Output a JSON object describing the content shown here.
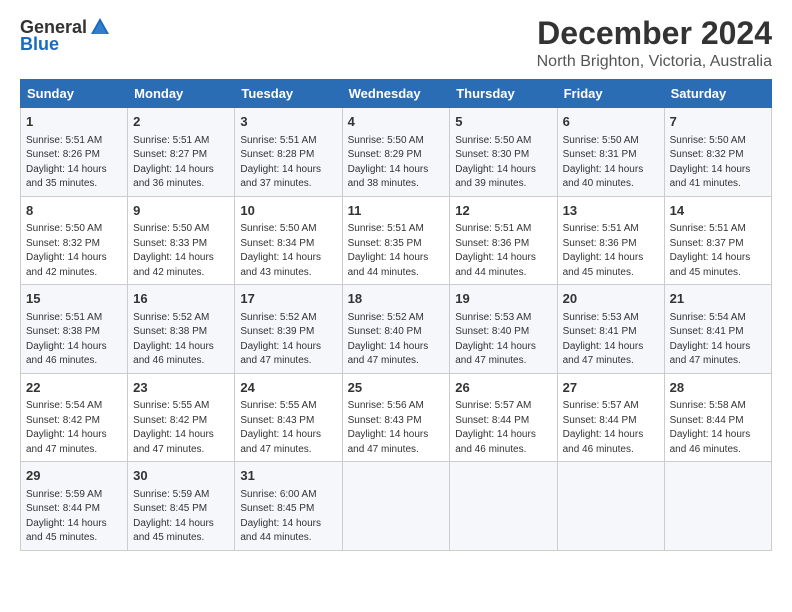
{
  "logo": {
    "general": "General",
    "blue": "Blue"
  },
  "header": {
    "month": "December 2024",
    "location": "North Brighton, Victoria, Australia"
  },
  "weekdays": [
    "Sunday",
    "Monday",
    "Tuesday",
    "Wednesday",
    "Thursday",
    "Friday",
    "Saturday"
  ],
  "weeks": [
    [
      {
        "day": "1",
        "sunrise": "5:51 AM",
        "sunset": "8:26 PM",
        "daylight": "14 hours and 35 minutes."
      },
      {
        "day": "2",
        "sunrise": "5:51 AM",
        "sunset": "8:27 PM",
        "daylight": "14 hours and 36 minutes."
      },
      {
        "day": "3",
        "sunrise": "5:51 AM",
        "sunset": "8:28 PM",
        "daylight": "14 hours and 37 minutes."
      },
      {
        "day": "4",
        "sunrise": "5:50 AM",
        "sunset": "8:29 PM",
        "daylight": "14 hours and 38 minutes."
      },
      {
        "day": "5",
        "sunrise": "5:50 AM",
        "sunset": "8:30 PM",
        "daylight": "14 hours and 39 minutes."
      },
      {
        "day": "6",
        "sunrise": "5:50 AM",
        "sunset": "8:31 PM",
        "daylight": "14 hours and 40 minutes."
      },
      {
        "day": "7",
        "sunrise": "5:50 AM",
        "sunset": "8:32 PM",
        "daylight": "14 hours and 41 minutes."
      }
    ],
    [
      {
        "day": "8",
        "sunrise": "5:50 AM",
        "sunset": "8:32 PM",
        "daylight": "14 hours and 42 minutes."
      },
      {
        "day": "9",
        "sunrise": "5:50 AM",
        "sunset": "8:33 PM",
        "daylight": "14 hours and 42 minutes."
      },
      {
        "day": "10",
        "sunrise": "5:50 AM",
        "sunset": "8:34 PM",
        "daylight": "14 hours and 43 minutes."
      },
      {
        "day": "11",
        "sunrise": "5:51 AM",
        "sunset": "8:35 PM",
        "daylight": "14 hours and 44 minutes."
      },
      {
        "day": "12",
        "sunrise": "5:51 AM",
        "sunset": "8:36 PM",
        "daylight": "14 hours and 44 minutes."
      },
      {
        "day": "13",
        "sunrise": "5:51 AM",
        "sunset": "8:36 PM",
        "daylight": "14 hours and 45 minutes."
      },
      {
        "day": "14",
        "sunrise": "5:51 AM",
        "sunset": "8:37 PM",
        "daylight": "14 hours and 45 minutes."
      }
    ],
    [
      {
        "day": "15",
        "sunrise": "5:51 AM",
        "sunset": "8:38 PM",
        "daylight": "14 hours and 46 minutes."
      },
      {
        "day": "16",
        "sunrise": "5:52 AM",
        "sunset": "8:38 PM",
        "daylight": "14 hours and 46 minutes."
      },
      {
        "day": "17",
        "sunrise": "5:52 AM",
        "sunset": "8:39 PM",
        "daylight": "14 hours and 47 minutes."
      },
      {
        "day": "18",
        "sunrise": "5:52 AM",
        "sunset": "8:40 PM",
        "daylight": "14 hours and 47 minutes."
      },
      {
        "day": "19",
        "sunrise": "5:53 AM",
        "sunset": "8:40 PM",
        "daylight": "14 hours and 47 minutes."
      },
      {
        "day": "20",
        "sunrise": "5:53 AM",
        "sunset": "8:41 PM",
        "daylight": "14 hours and 47 minutes."
      },
      {
        "day": "21",
        "sunrise": "5:54 AM",
        "sunset": "8:41 PM",
        "daylight": "14 hours and 47 minutes."
      }
    ],
    [
      {
        "day": "22",
        "sunrise": "5:54 AM",
        "sunset": "8:42 PM",
        "daylight": "14 hours and 47 minutes."
      },
      {
        "day": "23",
        "sunrise": "5:55 AM",
        "sunset": "8:42 PM",
        "daylight": "14 hours and 47 minutes."
      },
      {
        "day": "24",
        "sunrise": "5:55 AM",
        "sunset": "8:43 PM",
        "daylight": "14 hours and 47 minutes."
      },
      {
        "day": "25",
        "sunrise": "5:56 AM",
        "sunset": "8:43 PM",
        "daylight": "14 hours and 47 minutes."
      },
      {
        "day": "26",
        "sunrise": "5:57 AM",
        "sunset": "8:44 PM",
        "daylight": "14 hours and 46 minutes."
      },
      {
        "day": "27",
        "sunrise": "5:57 AM",
        "sunset": "8:44 PM",
        "daylight": "14 hours and 46 minutes."
      },
      {
        "day": "28",
        "sunrise": "5:58 AM",
        "sunset": "8:44 PM",
        "daylight": "14 hours and 46 minutes."
      }
    ],
    [
      {
        "day": "29",
        "sunrise": "5:59 AM",
        "sunset": "8:44 PM",
        "daylight": "14 hours and 45 minutes."
      },
      {
        "day": "30",
        "sunrise": "5:59 AM",
        "sunset": "8:45 PM",
        "daylight": "14 hours and 45 minutes."
      },
      {
        "day": "31",
        "sunrise": "6:00 AM",
        "sunset": "8:45 PM",
        "daylight": "14 hours and 44 minutes."
      },
      null,
      null,
      null,
      null
    ]
  ],
  "labels": {
    "sunrise": "Sunrise:",
    "sunset": "Sunset:",
    "daylight": "Daylight hours"
  }
}
